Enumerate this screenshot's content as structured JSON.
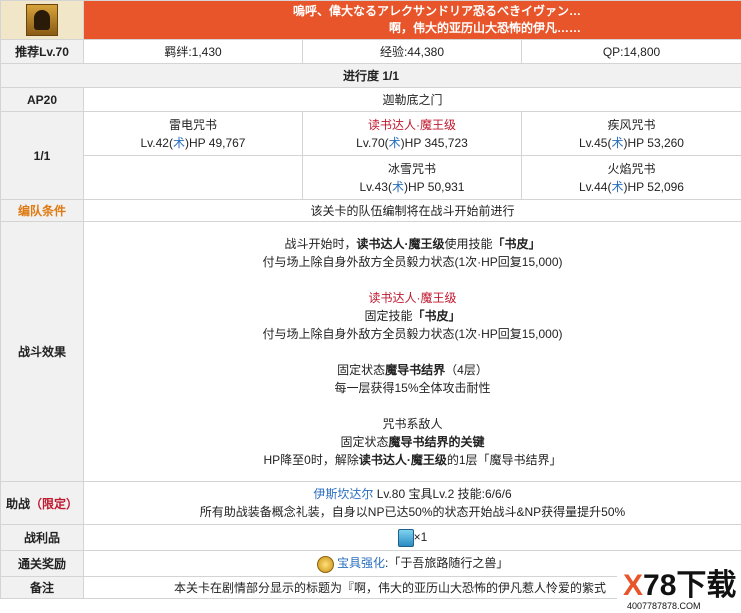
{
  "header": {
    "line1": "嗚呼、偉大なるアレクサンドリア恐るべきイヴァン…",
    "line2": "啊，伟大的亚历山大恐怖的伊凡……"
  },
  "recommend": {
    "label": "推荐Lv.70",
    "bond": "羁绊:1,430",
    "exp": "经验:44,380",
    "qp": "QP:14,800"
  },
  "progress": "进行度 1/1",
  "ap": {
    "label": "AP20",
    "location": "迦勒底之门"
  },
  "wave": {
    "label": "1/1",
    "enemies": [
      {
        "name": "雷电咒书",
        "lv": "Lv.42(",
        "class": "术",
        "hp": ")HP 49,767"
      },
      {
        "name": "读书达人·魔王级",
        "lv": "Lv.70(",
        "class": "术",
        "hp": ")HP 345,723"
      },
      {
        "name": "疾风咒书",
        "lv": "Lv.45(",
        "class": "术",
        "hp": ")HP 53,260"
      },
      {
        "name": "冰雪咒书",
        "lv": "Lv.43(",
        "class": "术",
        "hp": ")HP 50,931"
      },
      {
        "name": "火焰咒书",
        "lv": "Lv.44(",
        "class": "术",
        "hp": ")HP 52,096"
      }
    ]
  },
  "formation": {
    "label": "编队条件",
    "text": "该关卡的队伍编制将在战斗开始前进行"
  },
  "battle": {
    "label": "战斗效果",
    "s1_pre": "战斗开始时，",
    "s1_boss": "读书达人·魔王级",
    "s1_mid": "使用技能",
    "s1_skill": "「书皮」",
    "s1_line2": "付与场上除自身外敌方全员毅力状态(1次·HP回复15,000)",
    "s2_name": "读书达人·魔王级",
    "s2_line1a": "固定技能",
    "s2_skill": "「书皮」",
    "s2_line2": "付与场上除自身外敌方全员毅力状态(1次·HP回复15,000)",
    "s3_a": "固定状态",
    "s3_state": "魔导书结界",
    "s3_b": "（4层）",
    "s3_line2": "每一层获得15%全体攻击耐性",
    "s4_line1": "咒书系敌人",
    "s4_a": "固定状态",
    "s4_state": "魔导书结界的关键",
    "s4_c": "HP降至0时，解除",
    "s4_boss": "读书达人·魔王级",
    "s4_d": "的1层「魔导书结界」"
  },
  "support": {
    "label": "助战",
    "label2": "（限定）",
    "servant": "伊斯坎达尔",
    "info": " Lv.80 宝具Lv.2 技能:6/6/6",
    "desc": "所有助战装备概念礼装，自身以NP已达50%的状态开始战斗&NP获得量提升50%"
  },
  "drop": {
    "label": "战利品",
    "count": "×1"
  },
  "reward": {
    "label": "通关奖励",
    "link": "宝具强化",
    "text": ":「于吾旅路随行之兽」"
  },
  "note": {
    "label": "备注",
    "text": "本关卡在剧情部分显示的标题为『啊，伟大的亚历山大恐怖的伊凡惹人怜爱的紫式"
  },
  "watermark": {
    "brand": "78下载",
    "x": "X",
    "url": "4007787878.COM"
  }
}
